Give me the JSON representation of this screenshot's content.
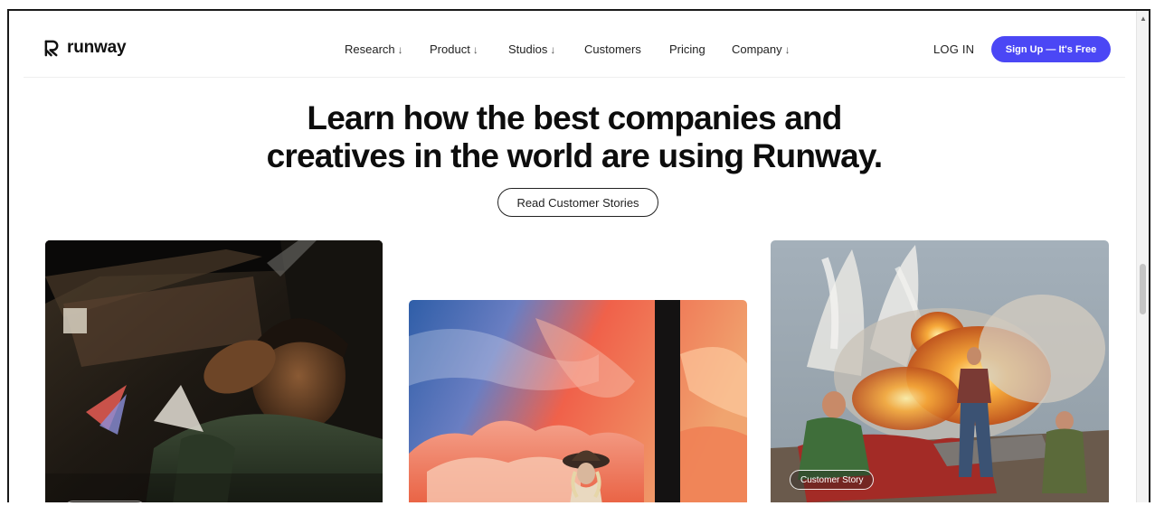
{
  "brand": {
    "name": "runway",
    "logo_icon": "runway-logo-icon",
    "color_primary": "#4b47f5"
  },
  "nav": {
    "items": [
      {
        "label": "Research",
        "arrow": "↓"
      },
      {
        "label": "Product",
        "arrow": "↓"
      },
      {
        "label": "Studios",
        "arrow": "↓"
      },
      {
        "label": "Customers",
        "arrow": ""
      },
      {
        "label": "Pricing",
        "arrow": ""
      },
      {
        "label": "Company",
        "arrow": "↓"
      }
    ],
    "login_label": "LOG IN",
    "signup_label": "Sign Up — It's Free"
  },
  "hero": {
    "title_line1": "Learn how the best companies and",
    "title_line2": "creatives in the world are using Runway.",
    "cta_label": "Read Customer Stories"
  },
  "cards": [
    {
      "image": "man-in-car-at-night-photo",
      "badge": ""
    },
    {
      "image": "woman-in-cowboy-hat-against-colorful-sky-photo",
      "badge": ""
    },
    {
      "image": "men-posing-in-front-of-explosion-photo",
      "badge": "Customer Story"
    }
  ]
}
